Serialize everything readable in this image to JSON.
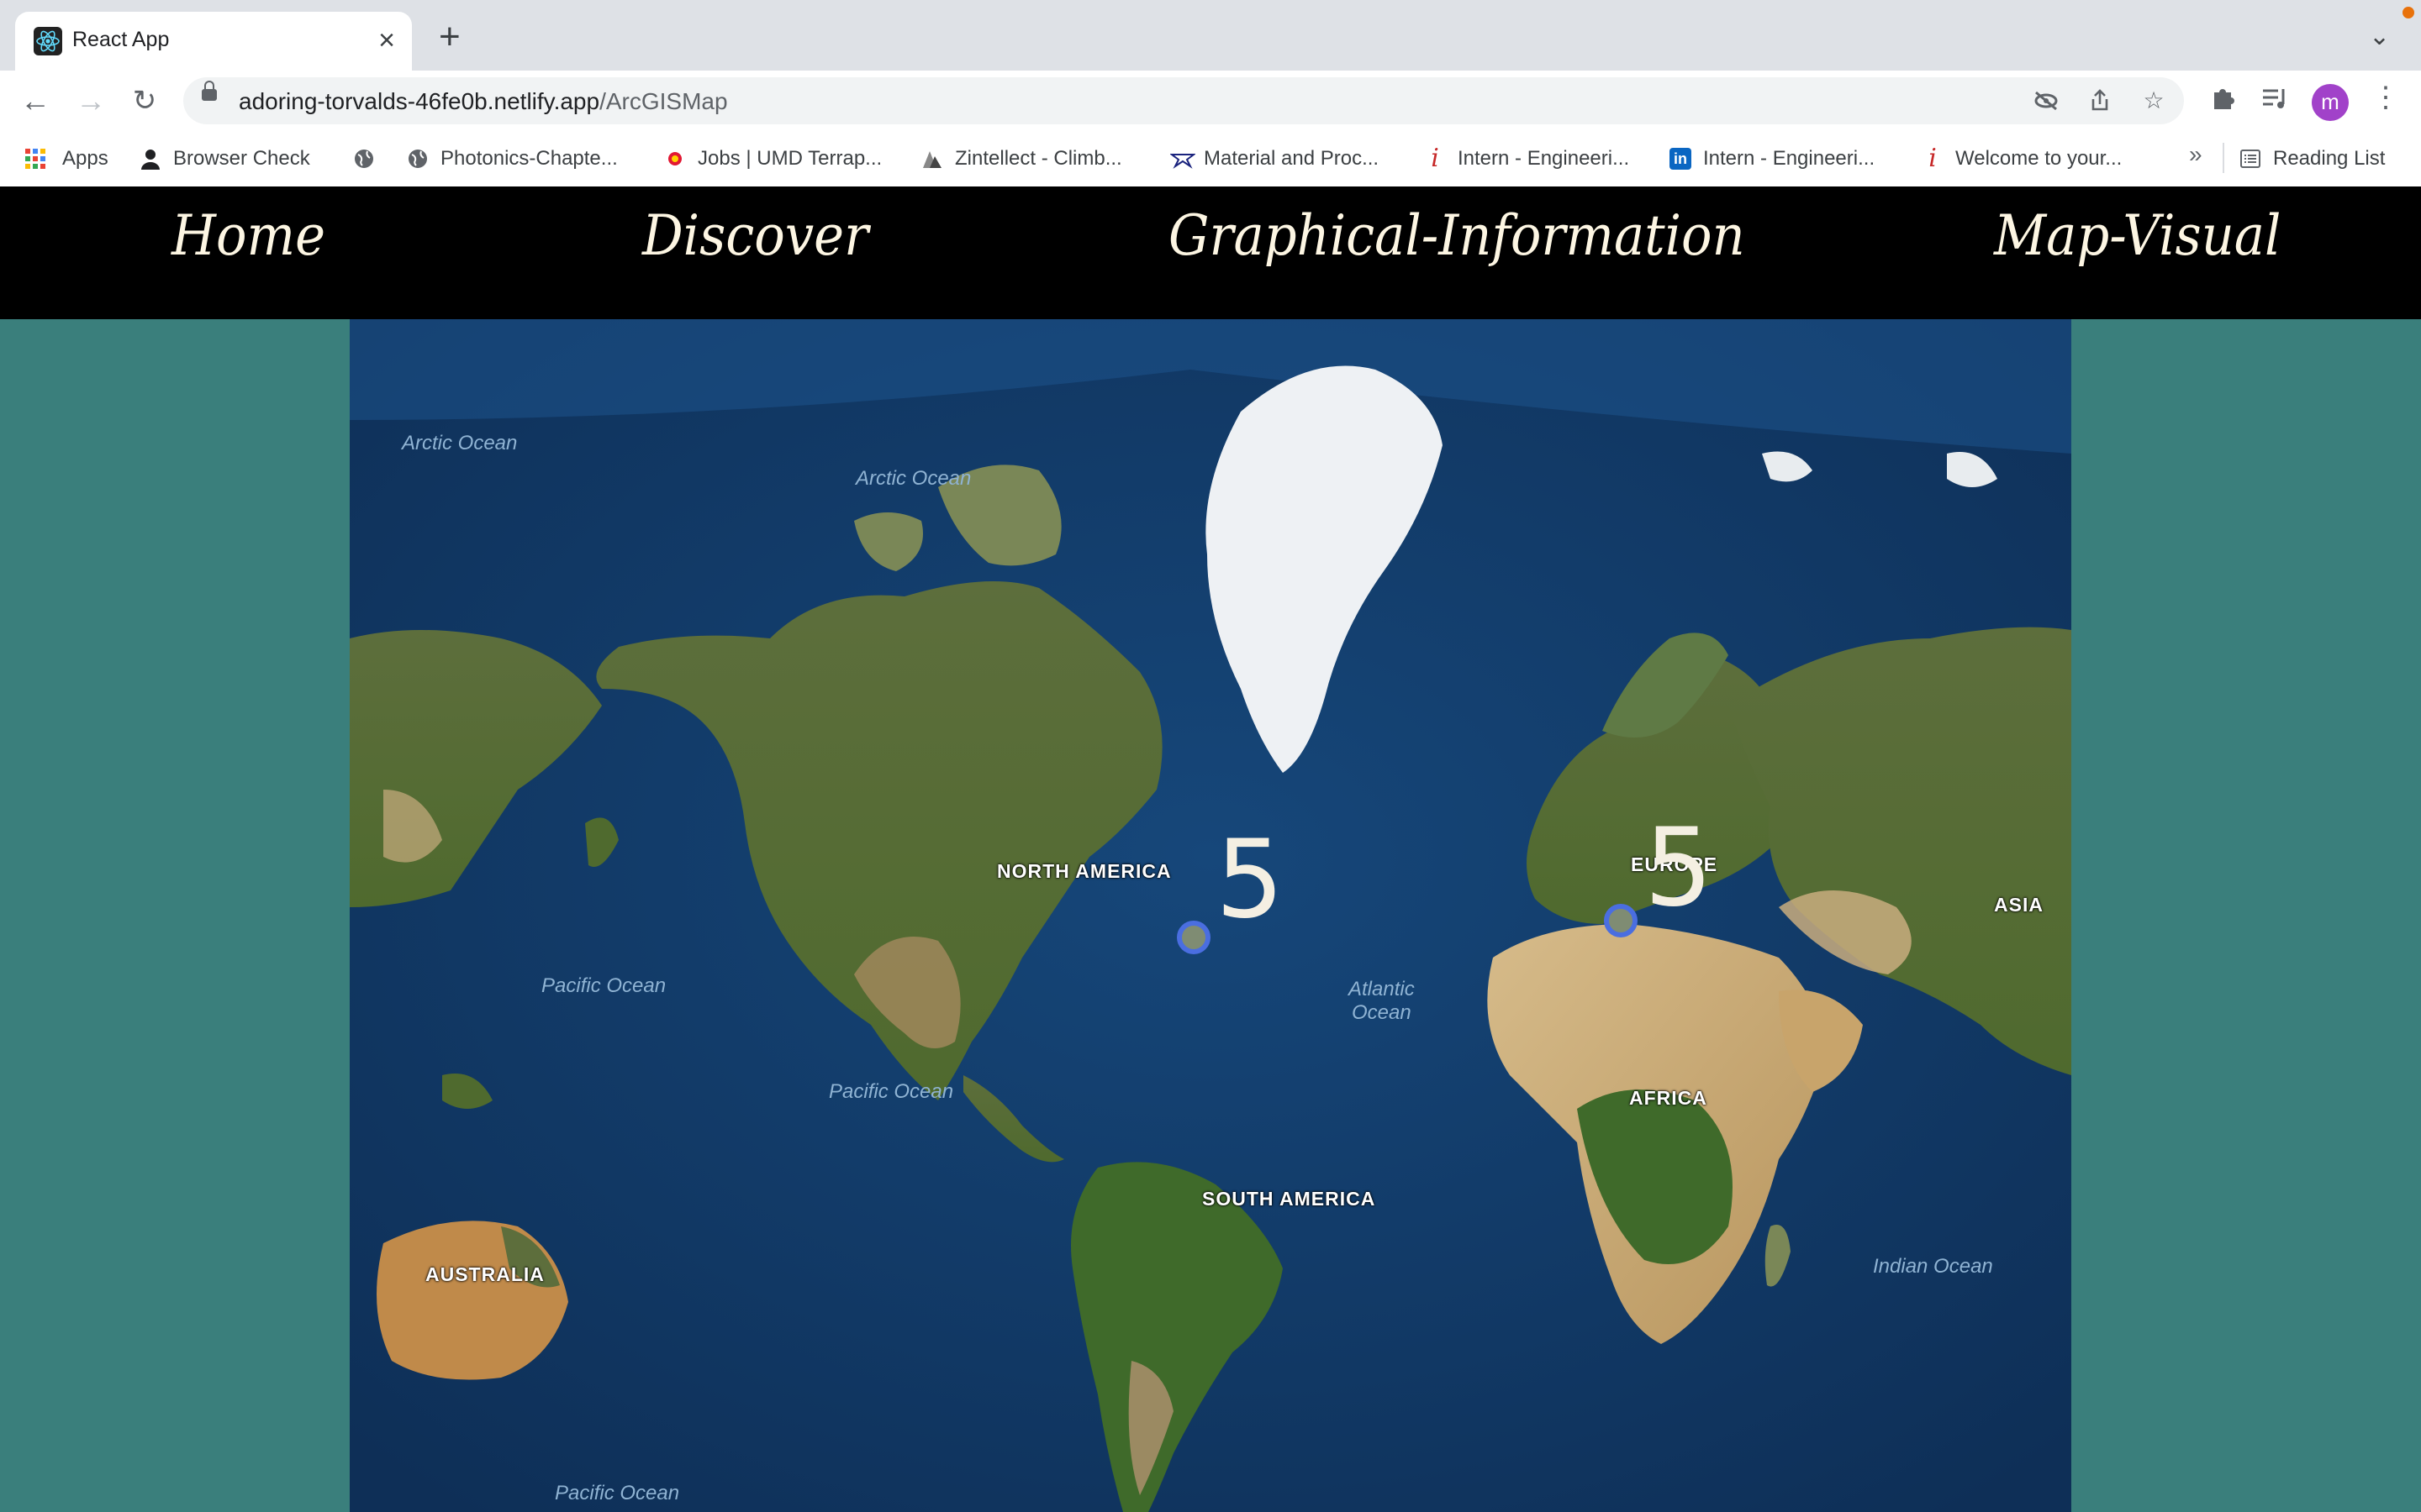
{
  "browser": {
    "tab_title": "React App",
    "url_host": "adoring-torvalds-46fe0b.netlify.app",
    "url_path": "/ArcGISMap",
    "profile_initial": "m",
    "icons": [
      "react-favicon",
      "close-icon",
      "new-tab-icon",
      "tab-search-icon",
      "back-icon",
      "forward-icon",
      "reload-icon",
      "lock-icon",
      "eye-off-icon",
      "share-icon",
      "star-icon",
      "extensions-icon",
      "media-icon",
      "menu-icon"
    ]
  },
  "bookmarks": {
    "items": [
      {
        "label": "Apps"
      },
      {
        "label": "Browser Check"
      },
      {
        "label": ""
      },
      {
        "label": "Photonics-Chapte..."
      },
      {
        "label": "Jobs | UMD Terrap..."
      },
      {
        "label": "Zintellect - Climb..."
      },
      {
        "label": "Material and Proc..."
      },
      {
        "label": "Intern - Engineeri..."
      },
      {
        "label": "Intern - Engineeri..."
      },
      {
        "label": "Welcome to your..."
      }
    ],
    "overflow": "»",
    "reading_list": "Reading List"
  },
  "nav": {
    "home": "Home",
    "discover": "Discover",
    "graphical": "Graphical-Information",
    "map_visual": "Map-Visual"
  },
  "map": {
    "oceans": [
      {
        "name": "Arctic Ocean"
      },
      {
        "name": "Arctic Ocean"
      },
      {
        "name": "Pacific Ocean"
      },
      {
        "name": "Pacific Ocean"
      },
      {
        "name": "Atlantic\nOcean"
      },
      {
        "name": "Indian Ocean"
      },
      {
        "name": "Pacific Ocean"
      }
    ],
    "continents": [
      {
        "name": "NORTH AMERICA"
      },
      {
        "name": "EUROPE"
      },
      {
        "name": "ASIA"
      },
      {
        "name": "AFRICA"
      },
      {
        "name": "SOUTH AMERICA"
      },
      {
        "name": "AUSTRALIA"
      }
    ],
    "clusters": [
      {
        "count": "5"
      },
      {
        "count": "5"
      }
    ],
    "colors": {
      "ocean": "#123c6a",
      "land": "#6b7a45",
      "ice": "#f2f4f6",
      "desert": "#c9ad7f",
      "marker": "#4a6ee0",
      "page_bg": "#3a7f7c"
    }
  }
}
